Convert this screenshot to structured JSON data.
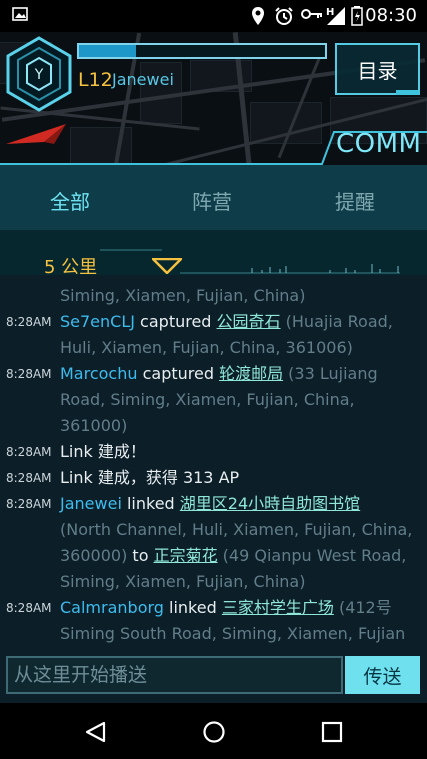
{
  "status_bar": {
    "time": "08:30",
    "icons": [
      "image-icon",
      "location-icon",
      "alarm-icon",
      "key-icon",
      "signal-icon",
      "battery-icon"
    ],
    "network_label": "H"
  },
  "header": {
    "level": "L12",
    "player_name": "Janewei",
    "xp_progress": 0.23,
    "ops_button_label": "目录",
    "comm_label": "COMM"
  },
  "tabs": [
    {
      "label": "全部",
      "active": true
    },
    {
      "label": "阵营",
      "active": false
    },
    {
      "label": "提醒",
      "active": false
    }
  ],
  "range": {
    "label": "5 公里"
  },
  "feed": [
    {
      "time": "",
      "parts": [
        {
          "text": "Siming, Xiamen, Fujian, China)",
          "kind": "addr"
        }
      ]
    },
    {
      "time": "8:28AM",
      "parts": [
        {
          "text": "Se7enCLJ",
          "kind": "agent"
        },
        {
          "text": " captured ",
          "kind": "plain"
        },
        {
          "text": "公园奇石",
          "kind": "portal"
        },
        {
          "text": " (Huajia Road, Huli, Xiamen, Fujian, China, 361006)",
          "kind": "addr"
        }
      ]
    },
    {
      "time": "8:28AM",
      "parts": [
        {
          "text": "Marcochu",
          "kind": "agent"
        },
        {
          "text": " captured ",
          "kind": "plain"
        },
        {
          "text": "轮渡邮局",
          "kind": "portal"
        },
        {
          "text": " (33 Lujiang Road, Siming, Xiamen, Fujian, China, 361000)",
          "kind": "addr"
        }
      ]
    },
    {
      "time": "8:28AM",
      "parts": [
        {
          "text": "Link 建成！",
          "kind": "plain"
        }
      ]
    },
    {
      "time": "8:28AM",
      "parts": [
        {
          "text": "Link 建成，获得 313 AP",
          "kind": "plain"
        }
      ]
    },
    {
      "time": "8:28AM",
      "parts": [
        {
          "text": "Janewei",
          "kind": "agent"
        },
        {
          "text": " linked ",
          "kind": "plain"
        },
        {
          "text": "湖里区24小時自助图书馆",
          "kind": "portal"
        },
        {
          "text": " (North Channel, Huli, Xiamen, Fujian, China, 360000)",
          "kind": "addr"
        },
        {
          "text": " to ",
          "kind": "plain"
        },
        {
          "text": "正宗菊花",
          "kind": "portal"
        },
        {
          "text": " (49 Qianpu West Road, Siming, Xiamen, Fujian, China)",
          "kind": "addr"
        }
      ]
    },
    {
      "time": "8:28AM",
      "parts": [
        {
          "text": "Calmranborg",
          "kind": "agent"
        },
        {
          "text": " linked ",
          "kind": "plain"
        },
        {
          "text": "三家村学生广场",
          "kind": "portal"
        },
        {
          "text": " (412号 Siming South Road, Siming, Xiamen, Fujian",
          "kind": "addr"
        }
      ]
    }
  ],
  "composer": {
    "placeholder": "从这里开始播送",
    "send_label": "传送"
  },
  "colors": {
    "accent": "#6ee0ee",
    "agent": "#3dbcee",
    "level": "#f4c141",
    "portal": "#8ee6d9"
  }
}
